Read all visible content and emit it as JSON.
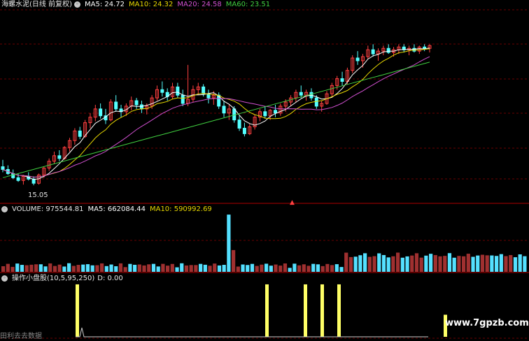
{
  "header": {
    "title": "海螺水泥(日线 前复权)",
    "ma": [
      {
        "label": "MA5: 24.72",
        "color": "#ffffff"
      },
      {
        "label": "MA10: 24.32",
        "color": "#e8d800"
      },
      {
        "label": "MA20: 24.58",
        "color": "#d050d0"
      },
      {
        "label": "MA60: 23.51",
        "color": "#40d040"
      }
    ]
  },
  "volume_header": {
    "title": "VOLUME: 975544.81",
    "ma5": "MA5: 662084.44",
    "ma10": "MA10: 590992.69"
  },
  "indicator_header": {
    "title": "操作小盘股(10,5,95,250)",
    "d": "D: 0.00"
  },
  "annotations": {
    "low_price": "15.05",
    "watermark": "www.7gpzb.com",
    "bottom_text": "田利去去数据"
  },
  "colors": {
    "up": "#ff4040",
    "down": "#54ffff",
    "vol_up": "#a03030",
    "vol_down": "#54e0ff",
    "signal": "#ffff66",
    "divider": "#b00000",
    "grid": "#6a0000"
  },
  "chart_data": {
    "type": "candlestick",
    "y_range_price": [
      14.5,
      27.5
    ],
    "candles": [
      [
        16.4,
        16.9,
        16.0,
        16.2
      ],
      [
        16.2,
        16.5,
        15.8,
        15.9
      ],
      [
        15.9,
        16.2,
        15.5,
        15.6
      ],
      [
        15.6,
        15.9,
        15.3,
        15.4
      ],
      [
        15.4,
        15.8,
        15.1,
        15.7
      ],
      [
        15.7,
        16.0,
        15.4,
        15.5
      ],
      [
        15.5,
        15.7,
        15.05,
        15.2
      ],
      [
        15.2,
        15.9,
        15.1,
        15.8
      ],
      [
        15.8,
        16.4,
        15.6,
        16.3
      ],
      [
        16.3,
        17.0,
        16.1,
        16.8
      ],
      [
        16.8,
        17.5,
        16.6,
        17.2
      ],
      [
        17.2,
        17.6,
        16.8,
        17.0
      ],
      [
        17.0,
        17.9,
        16.9,
        17.8
      ],
      [
        17.8,
        18.5,
        17.5,
        18.3
      ],
      [
        18.3,
        19.2,
        18.0,
        19.0
      ],
      [
        19.0,
        19.3,
        18.4,
        18.6
      ],
      [
        18.6,
        19.8,
        18.5,
        19.6
      ],
      [
        19.6,
        20.3,
        19.2,
        20.0
      ],
      [
        20.0,
        20.9,
        19.7,
        20.6
      ],
      [
        20.6,
        21.0,
        19.9,
        20.1
      ],
      [
        20.1,
        20.6,
        19.5,
        19.8
      ],
      [
        19.8,
        21.3,
        19.7,
        21.1
      ],
      [
        21.1,
        21.6,
        20.4,
        20.6
      ],
      [
        20.6,
        20.9,
        20.0,
        20.4
      ],
      [
        20.4,
        21.0,
        20.1,
        20.8
      ],
      [
        20.8,
        21.5,
        20.5,
        21.2
      ],
      [
        21.2,
        21.4,
        20.6,
        20.9
      ],
      [
        20.9,
        21.2,
        20.3,
        20.6
      ],
      [
        20.6,
        21.0,
        20.2,
        20.8
      ],
      [
        20.8,
        21.6,
        20.6,
        21.4
      ],
      [
        21.4,
        22.3,
        21.2,
        22.0
      ],
      [
        22.0,
        22.6,
        21.5,
        21.8
      ],
      [
        21.8,
        22.1,
        21.2,
        21.5
      ],
      [
        21.5,
        22.5,
        21.3,
        22.2
      ],
      [
        22.2,
        22.5,
        21.4,
        21.6
      ],
      [
        21.6,
        22.0,
        20.8,
        21.0
      ],
      [
        21.0,
        23.8,
        20.8,
        21.3
      ],
      [
        21.3,
        22.3,
        21.1,
        22.0
      ],
      [
        22.0,
        22.5,
        21.6,
        22.2
      ],
      [
        22.2,
        22.4,
        21.5,
        21.7
      ],
      [
        21.7,
        22.0,
        21.0,
        21.4
      ],
      [
        21.4,
        21.9,
        20.9,
        21.6
      ],
      [
        21.6,
        21.8,
        20.6,
        20.8
      ],
      [
        20.8,
        21.2,
        20.0,
        20.3
      ],
      [
        20.3,
        20.9,
        19.8,
        20.6
      ],
      [
        20.6,
        20.8,
        19.6,
        19.8
      ],
      [
        19.8,
        20.1,
        19.0,
        19.2
      ],
      [
        19.2,
        19.6,
        18.6,
        18.8
      ],
      [
        18.8,
        19.5,
        18.7,
        19.3
      ],
      [
        19.3,
        20.2,
        19.1,
        20.0
      ],
      [
        20.0,
        20.6,
        19.7,
        20.4
      ],
      [
        20.4,
        20.8,
        19.9,
        20.1
      ],
      [
        20.1,
        20.6,
        19.8,
        20.5
      ],
      [
        20.5,
        20.9,
        20.0,
        20.3
      ],
      [
        20.3,
        21.0,
        20.1,
        20.8
      ],
      [
        20.8,
        21.3,
        20.4,
        21.1
      ],
      [
        21.1,
        21.6,
        20.8,
        21.4
      ],
      [
        21.4,
        22.0,
        21.1,
        21.8
      ],
      [
        21.8,
        22.3,
        21.4,
        21.6
      ],
      [
        21.6,
        22.0,
        21.2,
        21.8
      ],
      [
        21.8,
        22.1,
        21.2,
        21.4
      ],
      [
        21.4,
        21.6,
        20.6,
        20.8
      ],
      [
        20.8,
        21.2,
        20.4,
        21.0
      ],
      [
        21.0,
        21.9,
        20.9,
        21.7
      ],
      [
        21.7,
        22.5,
        21.5,
        22.3
      ],
      [
        22.3,
        23.0,
        22.0,
        22.8
      ],
      [
        22.8,
        23.3,
        22.3,
        22.6
      ],
      [
        22.6,
        23.6,
        22.4,
        23.4
      ],
      [
        23.4,
        24.5,
        23.2,
        24.3
      ],
      [
        24.3,
        24.8,
        23.8,
        24.1
      ],
      [
        24.1,
        24.6,
        23.6,
        24.4
      ],
      [
        24.4,
        25.2,
        24.2,
        24.9
      ],
      [
        24.9,
        25.3,
        24.4,
        24.6
      ],
      [
        24.6,
        25.0,
        24.1,
        24.8
      ],
      [
        24.8,
        25.2,
        24.5,
        25.0
      ],
      [
        25.0,
        25.3,
        24.6,
        24.7
      ],
      [
        24.7,
        25.1,
        24.4,
        24.9
      ],
      [
        24.9,
        25.3,
        24.6,
        25.1
      ],
      [
        25.1,
        25.3,
        24.7,
        24.9
      ],
      [
        24.9,
        25.2,
        24.5,
        25.0
      ],
      [
        25.0,
        25.3,
        24.7,
        24.8
      ],
      [
        24.8,
        25.2,
        24.6,
        25.1
      ],
      [
        25.1,
        25.3,
        24.8,
        25.0
      ],
      [
        25.0,
        25.3,
        24.7,
        25.2
      ]
    ],
    "volume_series_note": "",
    "signals": [
      {
        "index": 0,
        "height": 0.95
      },
      {
        "index": 1,
        "height": 0.95
      },
      {
        "index": 2,
        "height": 0.95
      },
      {
        "index": 3,
        "height": 0.95
      },
      {
        "index": 4,
        "height": 0.95
      },
      {
        "index": 5,
        "height": 0.4
      }
    ],
    "signal_x": [
      110,
      381,
      436,
      460,
      484,
      636
    ]
  }
}
